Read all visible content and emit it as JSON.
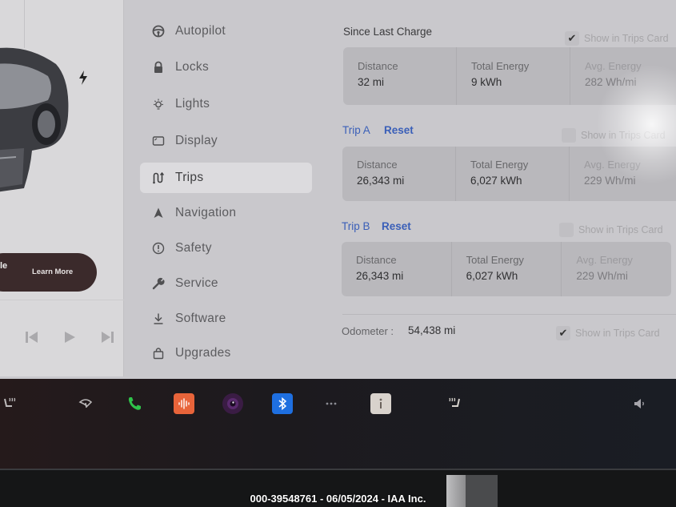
{
  "left_panel": {
    "promo_partial_text": "le",
    "learn_more_label": "Learn More"
  },
  "menu": {
    "items": [
      {
        "label": "Autopilot",
        "icon": "steering-wheel-icon",
        "active": false
      },
      {
        "label": "Locks",
        "icon": "lock-icon",
        "active": false
      },
      {
        "label": "Lights",
        "icon": "light-bulb-icon",
        "active": false
      },
      {
        "label": "Display",
        "icon": "display-icon",
        "active": false
      },
      {
        "label": "Trips",
        "icon": "trips-route-icon",
        "active": true
      },
      {
        "label": "Navigation",
        "icon": "navigation-arrow-icon",
        "active": false
      },
      {
        "label": "Safety",
        "icon": "safety-alert-icon",
        "active": false
      },
      {
        "label": "Service",
        "icon": "wrench-icon",
        "active": false
      },
      {
        "label": "Software",
        "icon": "download-icon",
        "active": false
      },
      {
        "label": "Upgrades",
        "icon": "shopping-bag-icon",
        "active": false
      }
    ]
  },
  "trips": {
    "since_last_charge": {
      "title": "Since Last Charge",
      "show_in_trips_card_label": "Show in Trips Card",
      "show_in_trips_card": true,
      "stats": [
        {
          "label": "Distance",
          "value": "32 mi"
        },
        {
          "label": "Total Energy",
          "value": "9 kWh"
        },
        {
          "label": "Avg. Energy",
          "value": "282 Wh/mi"
        }
      ]
    },
    "trip_a": {
      "title": "Trip A",
      "reset_label": "Reset",
      "show_in_trips_card_label": "Show in Trips Card",
      "show_in_trips_card": false,
      "stats": [
        {
          "label": "Distance",
          "value": "26,343 mi"
        },
        {
          "label": "Total Energy",
          "value": "6,027 kWh"
        },
        {
          "label": "Avg. Energy",
          "value": "229 Wh/mi"
        }
      ]
    },
    "trip_b": {
      "title": "Trip B",
      "reset_label": "Reset",
      "show_in_trips_card_label": "Show in Trips Card",
      "show_in_trips_card": false,
      "stats": [
        {
          "label": "Distance",
          "value": "26,343 mi"
        },
        {
          "label": "Total Energy",
          "value": "6,027 kWh"
        },
        {
          "label": "Avg. Energy",
          "value": "229 Wh/mi"
        }
      ]
    },
    "odometer": {
      "label": "Odometer :",
      "value": "54,438 mi",
      "show_in_trips_card_label": "Show in Trips Card",
      "show_in_trips_card": true
    }
  },
  "taskbar": {
    "icons": [
      "seat-heater-left-icon",
      "wiper-icon",
      "phone-icon",
      "audio-app-icon",
      "camera-icon",
      "bluetooth-icon",
      "more-apps-icon",
      "manual-info-icon",
      "seat-heater-right-icon",
      "volume-icon"
    ],
    "colors": {
      "phone": "#2fc24a",
      "audio": "#e8643a",
      "bluetooth": "#1e6fe0",
      "camera": "#5a2a6e"
    }
  },
  "checkmark_glyph": "✔",
  "watermark": "000-39548761 - 06/05/2024 - IAA Inc."
}
